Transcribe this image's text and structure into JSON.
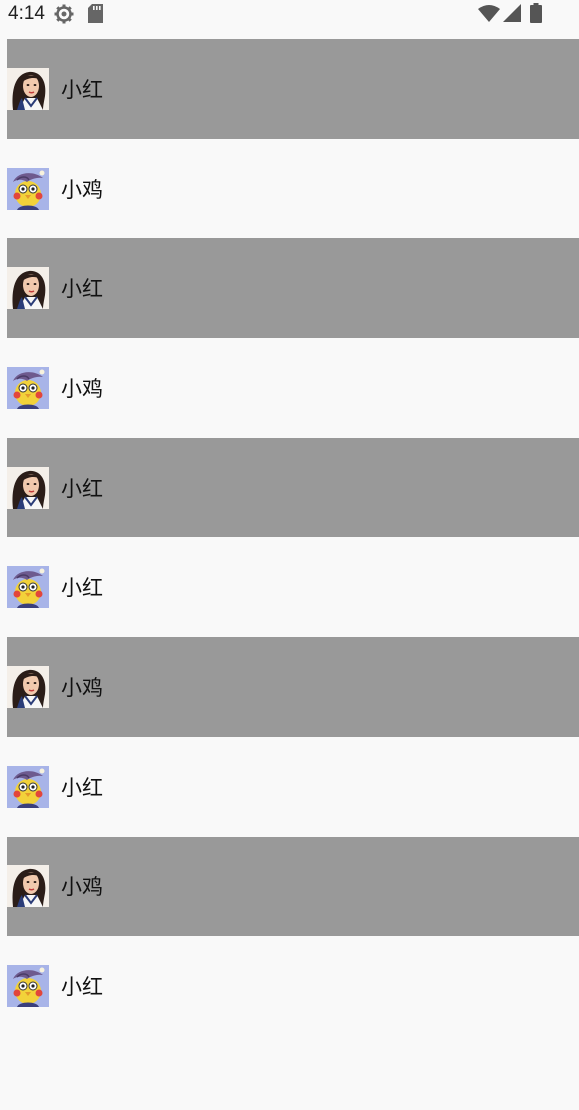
{
  "status_bar": {
    "time": "4:14",
    "icons": [
      "settings-gear-icon",
      "sd-card-icon",
      "wifi-icon",
      "cell-signal-icon",
      "battery-icon"
    ]
  },
  "colors": {
    "row_gray": "#999999",
    "row_light": "#f9f9f9"
  },
  "list": {
    "items": [
      {
        "name": "小红",
        "avatar": "girl-avatar",
        "style": "gray"
      },
      {
        "name": "小鸡",
        "avatar": "chick-avatar",
        "style": "light"
      },
      {
        "name": "小红",
        "avatar": "girl-avatar",
        "style": "gray"
      },
      {
        "name": "小鸡",
        "avatar": "chick-avatar",
        "style": "light"
      },
      {
        "name": "小红",
        "avatar": "girl-avatar",
        "style": "gray"
      },
      {
        "name": "小红",
        "avatar": "chick-avatar",
        "style": "light"
      },
      {
        "name": "小鸡",
        "avatar": "girl-avatar",
        "style": "gray"
      },
      {
        "name": "小红",
        "avatar": "chick-avatar",
        "style": "light"
      },
      {
        "name": "小鸡",
        "avatar": "girl-avatar",
        "style": "gray"
      },
      {
        "name": "小红",
        "avatar": "chick-avatar",
        "style": "light"
      }
    ]
  }
}
